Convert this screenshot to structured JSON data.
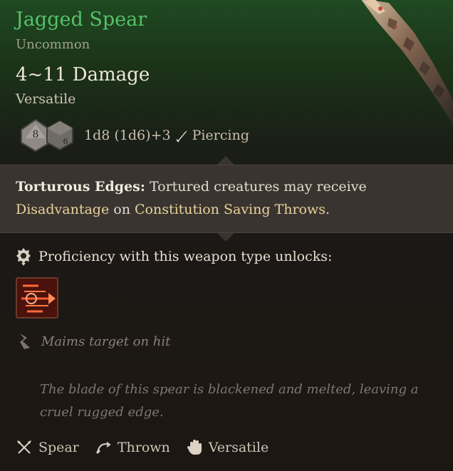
{
  "item": {
    "name": "Jagged Spear",
    "rarity": "Uncommon",
    "damage": "4~11 Damage",
    "property": "Versatile",
    "dice": {
      "die1": "8",
      "die2": "6",
      "formula": "1d8 (1d6)+3",
      "damage_type": "Piercing",
      "damage_type_icon": "piercing-icon"
    },
    "colors": {
      "name": "#55c26a",
      "rarity": "#a0a08a",
      "keyword": "#e7d39a"
    }
  },
  "passive": {
    "name": "Torturous Edges:",
    "text_1": " Tortured creatures may receive",
    "keyword_1": "Disadvantage",
    "text_2": " on ",
    "keyword_2": "Constitution",
    "text_3": " ",
    "keyword_3": "Saving Throws",
    "text_4": "."
  },
  "proficiency": {
    "label": "Proficiency with this weapon type unlocks:",
    "action_icon": "piercing-strike-action-icon"
  },
  "effect": {
    "text": "Maims target on hit",
    "icon": "maim-icon"
  },
  "flavor": "The blade of this spear is blackened and melted, leaving a cruel rugged edge.",
  "tags": [
    {
      "label": "Spear",
      "icon": "spear-icon"
    },
    {
      "label": "Thrown",
      "icon": "thrown-icon"
    },
    {
      "label": "Versatile",
      "icon": "hand-icon"
    }
  ]
}
